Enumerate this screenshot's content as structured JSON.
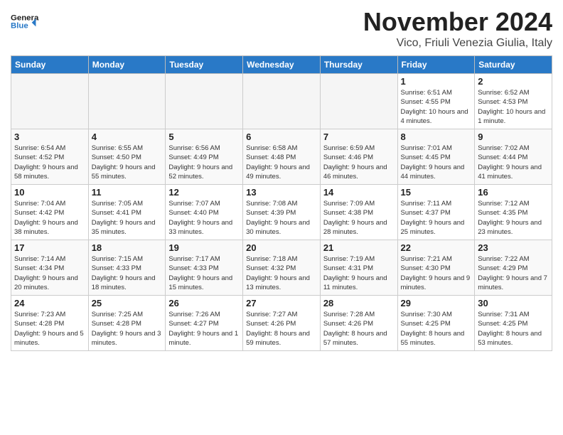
{
  "header": {
    "logo_line1": "General",
    "logo_line2": "Blue",
    "month_title": "November 2024",
    "subtitle": "Vico, Friuli Venezia Giulia, Italy"
  },
  "days_of_week": [
    "Sunday",
    "Monday",
    "Tuesday",
    "Wednesday",
    "Thursday",
    "Friday",
    "Saturday"
  ],
  "weeks": [
    [
      {
        "day": "",
        "info": ""
      },
      {
        "day": "",
        "info": ""
      },
      {
        "day": "",
        "info": ""
      },
      {
        "day": "",
        "info": ""
      },
      {
        "day": "",
        "info": ""
      },
      {
        "day": "1",
        "info": "Sunrise: 6:51 AM\nSunset: 4:55 PM\nDaylight: 10 hours and 4 minutes."
      },
      {
        "day": "2",
        "info": "Sunrise: 6:52 AM\nSunset: 4:53 PM\nDaylight: 10 hours and 1 minute."
      }
    ],
    [
      {
        "day": "3",
        "info": "Sunrise: 6:54 AM\nSunset: 4:52 PM\nDaylight: 9 hours and 58 minutes."
      },
      {
        "day": "4",
        "info": "Sunrise: 6:55 AM\nSunset: 4:50 PM\nDaylight: 9 hours and 55 minutes."
      },
      {
        "day": "5",
        "info": "Sunrise: 6:56 AM\nSunset: 4:49 PM\nDaylight: 9 hours and 52 minutes."
      },
      {
        "day": "6",
        "info": "Sunrise: 6:58 AM\nSunset: 4:48 PM\nDaylight: 9 hours and 49 minutes."
      },
      {
        "day": "7",
        "info": "Sunrise: 6:59 AM\nSunset: 4:46 PM\nDaylight: 9 hours and 46 minutes."
      },
      {
        "day": "8",
        "info": "Sunrise: 7:01 AM\nSunset: 4:45 PM\nDaylight: 9 hours and 44 minutes."
      },
      {
        "day": "9",
        "info": "Sunrise: 7:02 AM\nSunset: 4:44 PM\nDaylight: 9 hours and 41 minutes."
      }
    ],
    [
      {
        "day": "10",
        "info": "Sunrise: 7:04 AM\nSunset: 4:42 PM\nDaylight: 9 hours and 38 minutes."
      },
      {
        "day": "11",
        "info": "Sunrise: 7:05 AM\nSunset: 4:41 PM\nDaylight: 9 hours and 35 minutes."
      },
      {
        "day": "12",
        "info": "Sunrise: 7:07 AM\nSunset: 4:40 PM\nDaylight: 9 hours and 33 minutes."
      },
      {
        "day": "13",
        "info": "Sunrise: 7:08 AM\nSunset: 4:39 PM\nDaylight: 9 hours and 30 minutes."
      },
      {
        "day": "14",
        "info": "Sunrise: 7:09 AM\nSunset: 4:38 PM\nDaylight: 9 hours and 28 minutes."
      },
      {
        "day": "15",
        "info": "Sunrise: 7:11 AM\nSunset: 4:37 PM\nDaylight: 9 hours and 25 minutes."
      },
      {
        "day": "16",
        "info": "Sunrise: 7:12 AM\nSunset: 4:35 PM\nDaylight: 9 hours and 23 minutes."
      }
    ],
    [
      {
        "day": "17",
        "info": "Sunrise: 7:14 AM\nSunset: 4:34 PM\nDaylight: 9 hours and 20 minutes."
      },
      {
        "day": "18",
        "info": "Sunrise: 7:15 AM\nSunset: 4:33 PM\nDaylight: 9 hours and 18 minutes."
      },
      {
        "day": "19",
        "info": "Sunrise: 7:17 AM\nSunset: 4:33 PM\nDaylight: 9 hours and 15 minutes."
      },
      {
        "day": "20",
        "info": "Sunrise: 7:18 AM\nSunset: 4:32 PM\nDaylight: 9 hours and 13 minutes."
      },
      {
        "day": "21",
        "info": "Sunrise: 7:19 AM\nSunset: 4:31 PM\nDaylight: 9 hours and 11 minutes."
      },
      {
        "day": "22",
        "info": "Sunrise: 7:21 AM\nSunset: 4:30 PM\nDaylight: 9 hours and 9 minutes."
      },
      {
        "day": "23",
        "info": "Sunrise: 7:22 AM\nSunset: 4:29 PM\nDaylight: 9 hours and 7 minutes."
      }
    ],
    [
      {
        "day": "24",
        "info": "Sunrise: 7:23 AM\nSunset: 4:28 PM\nDaylight: 9 hours and 5 minutes."
      },
      {
        "day": "25",
        "info": "Sunrise: 7:25 AM\nSunset: 4:28 PM\nDaylight: 9 hours and 3 minutes."
      },
      {
        "day": "26",
        "info": "Sunrise: 7:26 AM\nSunset: 4:27 PM\nDaylight: 9 hours and 1 minute."
      },
      {
        "day": "27",
        "info": "Sunrise: 7:27 AM\nSunset: 4:26 PM\nDaylight: 8 hours and 59 minutes."
      },
      {
        "day": "28",
        "info": "Sunrise: 7:28 AM\nSunset: 4:26 PM\nDaylight: 8 hours and 57 minutes."
      },
      {
        "day": "29",
        "info": "Sunrise: 7:30 AM\nSunset: 4:25 PM\nDaylight: 8 hours and 55 minutes."
      },
      {
        "day": "30",
        "info": "Sunrise: 7:31 AM\nSunset: 4:25 PM\nDaylight: 8 hours and 53 minutes."
      }
    ]
  ]
}
